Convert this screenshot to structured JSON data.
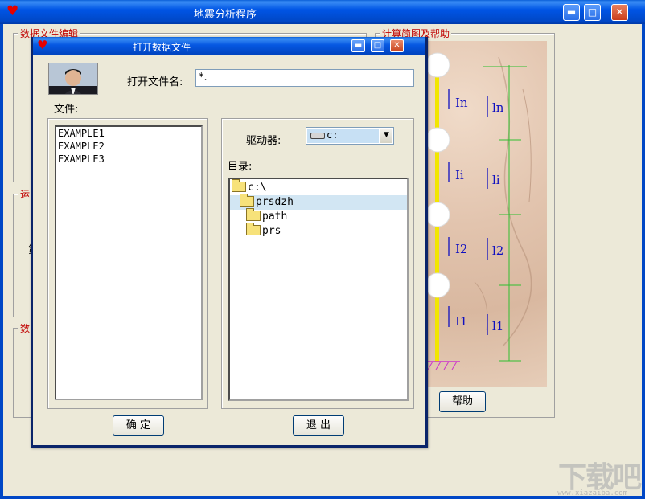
{
  "main_window": {
    "title": "地震分析程序",
    "buttons": {
      "minimize": "▬",
      "maximize": "□",
      "close": "✕"
    }
  },
  "groups": {
    "data_file_edit": "数据文件编辑",
    "diagram_help": "计算简图及帮助",
    "group3_partial": "运",
    "group3_text_partial": "第",
    "group4_partial": "数"
  },
  "diagram": {
    "labels_left": [
      "In",
      "Ii",
      "I2",
      "I1"
    ],
    "labels_right": [
      "ln",
      "li",
      "l2",
      "l1"
    ]
  },
  "help_button": "帮助",
  "dialog": {
    "title": "打开数据文件",
    "filename_label": "打开文件名:",
    "filename_value": "*.",
    "files_label": "文件:",
    "files": [
      "EXAMPLE1",
      "EXAMPLE2",
      "EXAMPLE3"
    ],
    "drive_label": "驱动器:",
    "drive_value": "c:",
    "dir_label": "目录:",
    "dirs": [
      {
        "name": "c:\\",
        "level": 0,
        "open": true
      },
      {
        "name": "prsdzh",
        "level": 1,
        "open": true,
        "selected": true
      },
      {
        "name": "path",
        "level": 2
      },
      {
        "name": "prs",
        "level": 2
      }
    ],
    "ok_button": "确 定",
    "exit_button": "退 出"
  },
  "watermark": {
    "text": "下载吧",
    "sub": "www.xiazaiba.com"
  }
}
